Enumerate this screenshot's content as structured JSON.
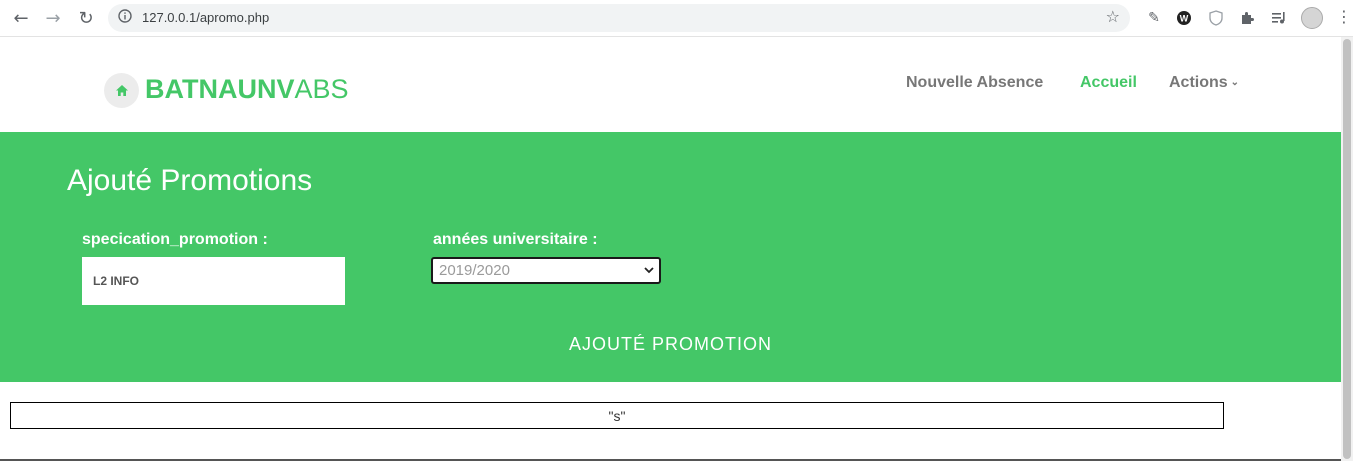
{
  "browser": {
    "url": "127.0.0.1/apromo.php"
  },
  "site": {
    "brand_bold": "BATNAUNV",
    "brand_light": "ABS",
    "nav": {
      "new_absence": "Nouvelle Absence",
      "home": "Accueil",
      "actions": "Actions"
    }
  },
  "form": {
    "title": "Ajouté Promotions",
    "spec_label": "specication_promotion :",
    "spec_value": "L2 INFO",
    "year_label": "années universitaire :",
    "year_selected": "2019/2020",
    "submit_label": "AJOUTÉ PROMOTION"
  },
  "result": {
    "text": "\"s\""
  },
  "colors": {
    "accent": "#44c767",
    "nav_text": "#777777"
  }
}
